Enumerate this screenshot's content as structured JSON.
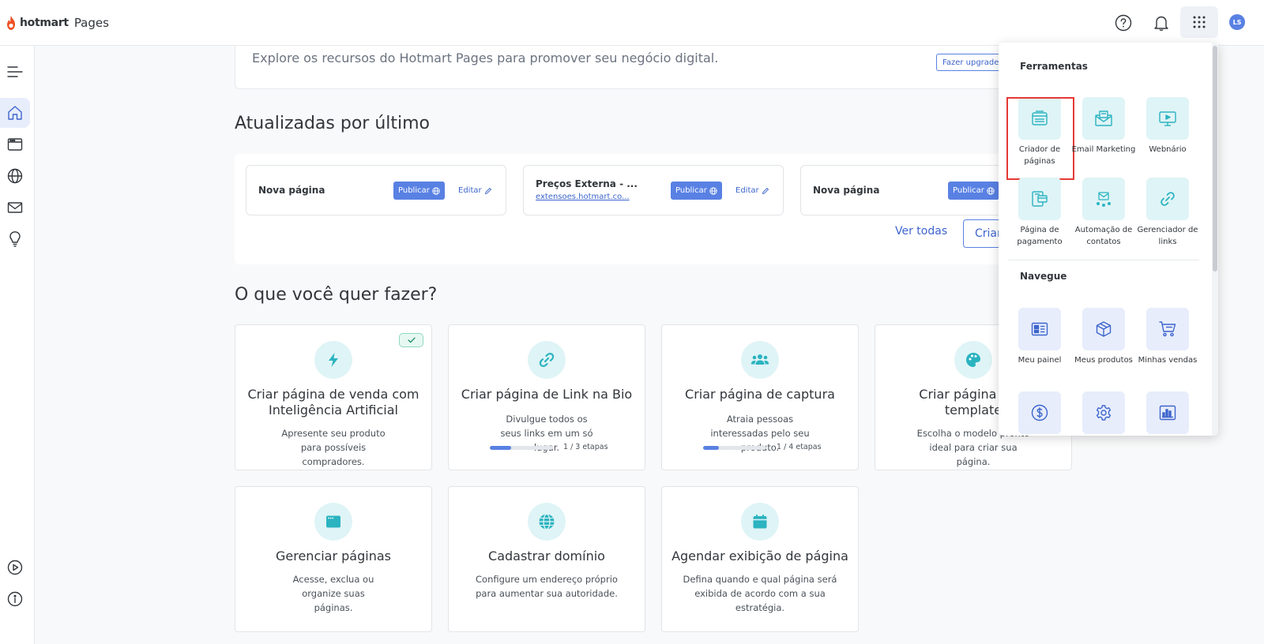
{
  "header": {
    "brand": "hotmart",
    "product": "Pages",
    "avatar_initials": "LS",
    "icons": [
      "help-icon",
      "bell-icon",
      "apps-grid-icon"
    ]
  },
  "sidebar": {
    "items": [
      {
        "name": "menu-icon"
      },
      {
        "name": "home-icon",
        "active": true
      },
      {
        "name": "browser-window-icon"
      },
      {
        "name": "globe-icon"
      },
      {
        "name": "mail-icon"
      },
      {
        "name": "lightbulb-icon"
      },
      {
        "name": "play-circle-icon"
      },
      {
        "name": "info-icon"
      }
    ]
  },
  "banner": {
    "text": "Explore os recursos do Hotmart Pages para promover seu negócio digital.",
    "upgrade_label": "Fazer upgrade"
  },
  "recent": {
    "title": "Atualizadas por último",
    "cards": [
      {
        "name": "Nova página",
        "link": "",
        "publish_label": "Publicar",
        "edit_label": "Editar"
      },
      {
        "name": "Preços Externa - ...",
        "link": "extensoes.hotmart.co...",
        "publish_label": "Publicar",
        "edit_label": "Editar"
      },
      {
        "name": "Nova página",
        "link": "",
        "publish_label": "Publicar",
        "edit_label": "Editar"
      }
    ],
    "see_all_label": "Ver todas",
    "create_label": "Criar"
  },
  "actions": {
    "title": "O que você quer fazer?",
    "cards": [
      {
        "title": "Criar página de venda com Inteligência Artificial",
        "desc": "Apresente seu produto para possíveis compradores.",
        "icon": "lightning-icon",
        "completed": true
      },
      {
        "title": "Criar página de Link na Bio",
        "desc": "Divulgue todos os seus links em um só lugar.",
        "icon": "link-icon",
        "progress_text": "1 / 3 etapas",
        "progress": 0.333
      },
      {
        "title": "Criar página de captura",
        "desc": "Atraia pessoas interessadas pelo seu produto.",
        "icon": "users-icon",
        "progress_text": "1 / 4 etapas",
        "progress": 0.25
      },
      {
        "title": "Criar página com template",
        "desc": "Escolha o modelo pronto ideal para criar sua página.",
        "icon": "palette-icon"
      },
      {
        "title": "Gerenciar páginas",
        "desc": "Acesse, exclua ou organize suas páginas.",
        "icon": "window-icon"
      },
      {
        "title": "Cadastrar domínio",
        "desc": "Configure um endereço próprio para aumentar sua autoridade.",
        "icon": "globe-icon"
      },
      {
        "title": "Agendar exibição de página",
        "desc": "Defina quando e qual página será exibida de acordo com a sua estratégia.",
        "icon": "calendar-icon"
      }
    ]
  },
  "apps_menu": {
    "tools_heading": "Ferramentas",
    "tools": [
      {
        "label": "Criador de páginas",
        "icon": "page-builder-icon",
        "highlighted": true
      },
      {
        "label": "Email Marketing",
        "icon": "email-marketing-icon"
      },
      {
        "label": "Webnário",
        "icon": "webinar-icon"
      },
      {
        "label": "Página de pagamento",
        "icon": "payment-page-icon"
      },
      {
        "label": "Automação de contatos",
        "icon": "contact-automation-icon"
      },
      {
        "label": "Gerenciador de links",
        "icon": "link-manager-icon"
      }
    ],
    "navigate_heading": "Navegue",
    "navigate": [
      {
        "label": "Meu painel",
        "icon": "dashboard-icon"
      },
      {
        "label": "Meus produtos",
        "icon": "box-icon"
      },
      {
        "label": "Minhas vendas",
        "icon": "cart-icon"
      },
      {
        "label": "",
        "icon": "dollar-icon"
      },
      {
        "label": "",
        "icon": "settings-icon"
      },
      {
        "label": "",
        "icon": "bar-chart-icon"
      }
    ]
  },
  "colors": {
    "accent": "#5981e3",
    "teal_bg": "#dff4f6",
    "teal_icon": "#2bb3c0",
    "highlight": "#e53935"
  }
}
